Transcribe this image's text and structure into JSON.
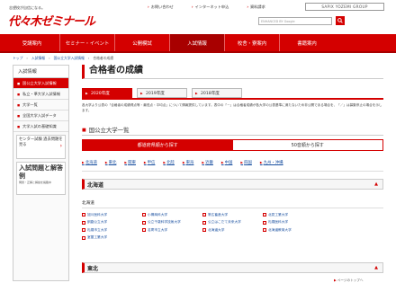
{
  "header": {
    "logo_sub": "志望校が自信になる。",
    "logo": "代々木ゼミナール",
    "links": [
      "お問い合わせ",
      "インターネット申込",
      "資料請求"
    ],
    "sapix": "SAPIX YOZEMI GROUP",
    "search_brand": "Google",
    "search_placeholder": "ENHANCED BY Google"
  },
  "nav": [
    "受講案内",
    "セミナー・イベント",
    "公開模試",
    "入試情報",
    "校舎・寮案内",
    "書籍案内"
  ],
  "breadcrumb": [
    "トップ",
    "入試情報",
    "国公立大学入試情報",
    "合格者の成績"
  ],
  "sidebar": {
    "heading": "入試情報",
    "items": [
      "国公立大学入試情報",
      "私立・準大学入試情報",
      "大学一覧",
      "全国大学入試データ",
      "大学入試の基礎知識"
    ],
    "banner1": "センター試験 過去問題を見る",
    "banner2_title": "入試問題と解答例",
    "banner2_sub": "問題・正解と解説を掲載中"
  },
  "main": {
    "title": "合格者の成績",
    "year_tabs": [
      "2020年度",
      "2019年度",
      "2018年度"
    ],
    "desc": "各大学より公表の「合格者の成績得点等・最低点・平均点」について情報提供しています。表中の「－」は合格者成績が各大学の公表基準に満たないため非公開である場合を、「／」は募集停止の場合を示します。",
    "section_title": "国公立大学一覧",
    "sort_tabs": [
      "都道府県順から探す",
      "50音順から探す"
    ],
    "regions": [
      "北海道",
      "東北",
      "関東",
      "甲信",
      "北陸",
      "東海",
      "近畿",
      "中国",
      "四国",
      "九州・沖縄"
    ],
    "region_hokkaido": "北海道",
    "pref_hokkaido": "北海道",
    "universities": [
      [
        "旭川医科大学",
        "小樽商科大学",
        "帯広畜産大学",
        "北見工業大学"
      ],
      [
        "釧路公立大学",
        "公立千歳科学技術大学",
        "公立はこだて未来大学",
        "札幌医科大学"
      ],
      [
        "札幌市立大学",
        "名寄市立大学",
        "北海道大学",
        "北海道教育大学"
      ],
      [
        "室蘭工業大学",
        "",
        "",
        ""
      ]
    ],
    "to_top": "ページのトップへ",
    "region_tohoku": "東北"
  },
  "colors": {
    "accent": "#d40000",
    "link": "#1a50a0"
  }
}
